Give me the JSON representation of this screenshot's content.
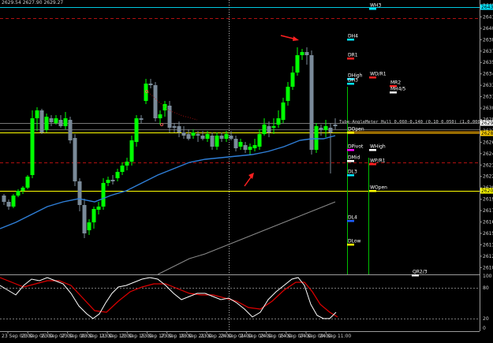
{
  "header": {
    "info": "2629.54 2627.90 2629.27"
  },
  "price_axis": {
    "labels": [
      "2642.55",
      "2641.40",
      "2640.00",
      "2638.60",
      "2637.25",
      "2635.85",
      "2634.45",
      "2633.10",
      "2631.70",
      "2630.30",
      "2628.90",
      "2627.55",
      "2626.15",
      "2624.75",
      "2623.40",
      "2622.00",
      "2620.60",
      "2619.25",
      "2617.85",
      "2616.45",
      "2615.05",
      "2613.70",
      "2612.30",
      "2610.90"
    ],
    "tags": [
      {
        "text": "2643.90",
        "color": "#00e5ff"
      },
      {
        "text": "2629.27",
        "color": "#ffffff"
      },
      {
        "text": "2628.20",
        "color": "#ffd000"
      },
      {
        "text": "2620.40",
        "color": "#ffff00"
      }
    ]
  },
  "time_axis": {
    "labels": [
      "23 Sep 03:00",
      "23 Sep 05:00",
      "23 Sep 07:00",
      "23 Sep 09:00",
      "23 Sep 11:00",
      "23 Sep 13:00",
      "23 Sep 15:00",
      "23 Sep 17:00",
      "23 Sep 19:00",
      "23 Sep 21:00",
      "23 Sep 23:00",
      "24 Sep 01:00",
      "24 Sep 03:00",
      "24 Sep 05:00",
      "24 Sep 07:00",
      "24 Sep 09:00",
      "24 Sep 11:00"
    ]
  },
  "oscillator_axis": {
    "labels": [
      "100",
      "80",
      "20",
      "0"
    ]
  },
  "overlay_text": "Tube-AngleMeter Hull 0,060-0,140 (0.10 0.050) (1,0.00000)",
  "levels": [
    {
      "name": "WH3",
      "color": "#00e5ff",
      "label_color": "#ffffff"
    },
    {
      "name": "DH4",
      "color": "#00e5ff",
      "label_color": "#ffffff"
    },
    {
      "name": "DR1",
      "color": "#ff2020",
      "label_color": "#ffffff"
    },
    {
      "name": "DHigh",
      "color": "#00e5ff",
      "label_color": "#ffffff"
    },
    {
      "name": "DH3",
      "color": "#00e5ff",
      "label_color": "#ffffff"
    },
    {
      "name": "WD/R1",
      "color": "#ff2020",
      "label_color": "#ffffff"
    },
    {
      "name": "MR2",
      "color": "#ff2020",
      "label_color": "#ffffff"
    },
    {
      "name": "MH4/5",
      "color": "#ffffff",
      "label_color": "#ffffff"
    },
    {
      "name": "DOpen",
      "color": "#ffff00",
      "label_color": "#ffffff"
    },
    {
      "name": "DPivot",
      "color": "#ff00ff",
      "label_color": "#ffffff"
    },
    {
      "name": "WHigh",
      "color": "#ffffff",
      "label_color": "#ffffff"
    },
    {
      "name": "DMid",
      "color": "#ffffff",
      "label_color": "#ffffff"
    },
    {
      "name": "WP/R1",
      "color": "#ff2020",
      "label_color": "#ffffff"
    },
    {
      "name": "DL3",
      "color": "#00e5ff",
      "label_color": "#ffffff"
    },
    {
      "name": "WOpen",
      "color": "#ffff00",
      "label_color": "#ffffff"
    },
    {
      "name": "DL4",
      "color": "#2060ff",
      "label_color": "#ffffff"
    },
    {
      "name": "DLow",
      "color": "#ffff00",
      "label_color": "#ffffff"
    },
    {
      "name": "QR2/3",
      "color": "#ffffff",
      "label_color": "#ffffff"
    }
  ],
  "colors": {
    "bull": "#00ff00",
    "bear": "#7a8a99",
    "ma_fast": "#2f7fd8",
    "ma_slow": "#8a8a8a",
    "stoch_main": "#ffffff",
    "stoch_signal": "#e00000",
    "hline_yellow": "#ffff00",
    "hline_red_dash": "#b01010",
    "arrow": "#ff2020"
  }
}
